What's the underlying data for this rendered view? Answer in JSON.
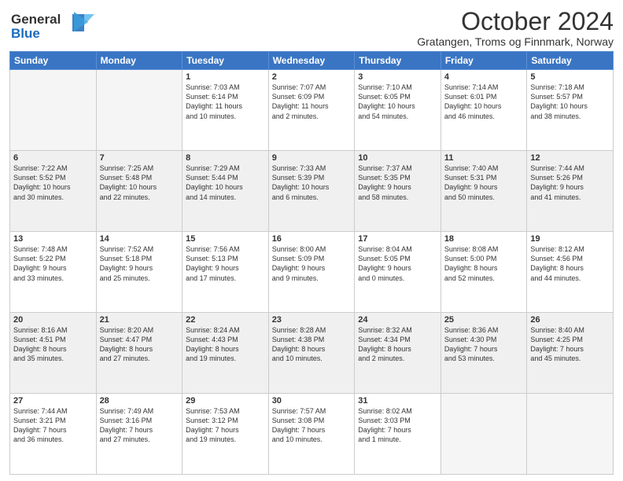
{
  "header": {
    "logo_line1": "General",
    "logo_line2": "Blue",
    "title": "October 2024",
    "subtitle": "Gratangen, Troms og Finnmark, Norway"
  },
  "days_of_week": [
    "Sunday",
    "Monday",
    "Tuesday",
    "Wednesday",
    "Thursday",
    "Friday",
    "Saturday"
  ],
  "weeks": [
    [
      {
        "day": "",
        "info": ""
      },
      {
        "day": "",
        "info": ""
      },
      {
        "day": "1",
        "info": "Sunrise: 7:03 AM\nSunset: 6:14 PM\nDaylight: 11 hours\nand 10 minutes."
      },
      {
        "day": "2",
        "info": "Sunrise: 7:07 AM\nSunset: 6:09 PM\nDaylight: 11 hours\nand 2 minutes."
      },
      {
        "day": "3",
        "info": "Sunrise: 7:10 AM\nSunset: 6:05 PM\nDaylight: 10 hours\nand 54 minutes."
      },
      {
        "day": "4",
        "info": "Sunrise: 7:14 AM\nSunset: 6:01 PM\nDaylight: 10 hours\nand 46 minutes."
      },
      {
        "day": "5",
        "info": "Sunrise: 7:18 AM\nSunset: 5:57 PM\nDaylight: 10 hours\nand 38 minutes."
      }
    ],
    [
      {
        "day": "6",
        "info": "Sunrise: 7:22 AM\nSunset: 5:52 PM\nDaylight: 10 hours\nand 30 minutes."
      },
      {
        "day": "7",
        "info": "Sunrise: 7:25 AM\nSunset: 5:48 PM\nDaylight: 10 hours\nand 22 minutes."
      },
      {
        "day": "8",
        "info": "Sunrise: 7:29 AM\nSunset: 5:44 PM\nDaylight: 10 hours\nand 14 minutes."
      },
      {
        "day": "9",
        "info": "Sunrise: 7:33 AM\nSunset: 5:39 PM\nDaylight: 10 hours\nand 6 minutes."
      },
      {
        "day": "10",
        "info": "Sunrise: 7:37 AM\nSunset: 5:35 PM\nDaylight: 9 hours\nand 58 minutes."
      },
      {
        "day": "11",
        "info": "Sunrise: 7:40 AM\nSunset: 5:31 PM\nDaylight: 9 hours\nand 50 minutes."
      },
      {
        "day": "12",
        "info": "Sunrise: 7:44 AM\nSunset: 5:26 PM\nDaylight: 9 hours\nand 41 minutes."
      }
    ],
    [
      {
        "day": "13",
        "info": "Sunrise: 7:48 AM\nSunset: 5:22 PM\nDaylight: 9 hours\nand 33 minutes."
      },
      {
        "day": "14",
        "info": "Sunrise: 7:52 AM\nSunset: 5:18 PM\nDaylight: 9 hours\nand 25 minutes."
      },
      {
        "day": "15",
        "info": "Sunrise: 7:56 AM\nSunset: 5:13 PM\nDaylight: 9 hours\nand 17 minutes."
      },
      {
        "day": "16",
        "info": "Sunrise: 8:00 AM\nSunset: 5:09 PM\nDaylight: 9 hours\nand 9 minutes."
      },
      {
        "day": "17",
        "info": "Sunrise: 8:04 AM\nSunset: 5:05 PM\nDaylight: 9 hours\nand 0 minutes."
      },
      {
        "day": "18",
        "info": "Sunrise: 8:08 AM\nSunset: 5:00 PM\nDaylight: 8 hours\nand 52 minutes."
      },
      {
        "day": "19",
        "info": "Sunrise: 8:12 AM\nSunset: 4:56 PM\nDaylight: 8 hours\nand 44 minutes."
      }
    ],
    [
      {
        "day": "20",
        "info": "Sunrise: 8:16 AM\nSunset: 4:51 PM\nDaylight: 8 hours\nand 35 minutes."
      },
      {
        "day": "21",
        "info": "Sunrise: 8:20 AM\nSunset: 4:47 PM\nDaylight: 8 hours\nand 27 minutes."
      },
      {
        "day": "22",
        "info": "Sunrise: 8:24 AM\nSunset: 4:43 PM\nDaylight: 8 hours\nand 19 minutes."
      },
      {
        "day": "23",
        "info": "Sunrise: 8:28 AM\nSunset: 4:38 PM\nDaylight: 8 hours\nand 10 minutes."
      },
      {
        "day": "24",
        "info": "Sunrise: 8:32 AM\nSunset: 4:34 PM\nDaylight: 8 hours\nand 2 minutes."
      },
      {
        "day": "25",
        "info": "Sunrise: 8:36 AM\nSunset: 4:30 PM\nDaylight: 7 hours\nand 53 minutes."
      },
      {
        "day": "26",
        "info": "Sunrise: 8:40 AM\nSunset: 4:25 PM\nDaylight: 7 hours\nand 45 minutes."
      }
    ],
    [
      {
        "day": "27",
        "info": "Sunrise: 7:44 AM\nSunset: 3:21 PM\nDaylight: 7 hours\nand 36 minutes."
      },
      {
        "day": "28",
        "info": "Sunrise: 7:49 AM\nSunset: 3:16 PM\nDaylight: 7 hours\nand 27 minutes."
      },
      {
        "day": "29",
        "info": "Sunrise: 7:53 AM\nSunset: 3:12 PM\nDaylight: 7 hours\nand 19 minutes."
      },
      {
        "day": "30",
        "info": "Sunrise: 7:57 AM\nSunset: 3:08 PM\nDaylight: 7 hours\nand 10 minutes."
      },
      {
        "day": "31",
        "info": "Sunrise: 8:02 AM\nSunset: 3:03 PM\nDaylight: 7 hours\nand 1 minute."
      },
      {
        "day": "",
        "info": ""
      },
      {
        "day": "",
        "info": ""
      }
    ]
  ]
}
